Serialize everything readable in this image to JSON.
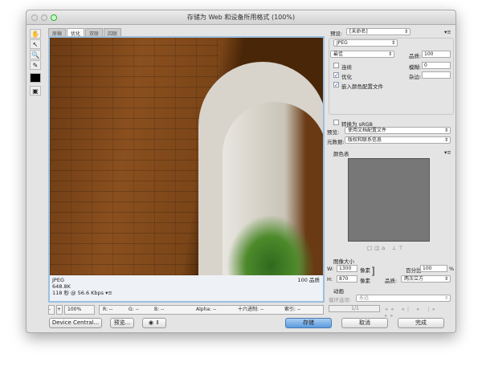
{
  "window": {
    "title": "存储为 Web 和设备所用格式 (100%)"
  },
  "tabs": [
    "原稿",
    "优化",
    "双联",
    "四联"
  ],
  "active_tab": 1,
  "image_info": {
    "format": "JPEG",
    "size": "648.8K",
    "time": "118 秒 @ 56.6 Kbps",
    "menu": "▾≡",
    "quality": "100 品质"
  },
  "status_bar": {
    "zoom": "100%",
    "r": "R: --",
    "g": "G: --",
    "b": "B: --",
    "alpha": "Alpha: --",
    "hex": "十六进制: --",
    "index": "索引: --"
  },
  "buttons": {
    "device_central": "Device Central...",
    "preview": "预览...",
    "save": "存储",
    "cancel": "取消",
    "done": "完成"
  },
  "settings": {
    "preset_label": "预设:",
    "preset": "[未命名]",
    "format": "JPEG",
    "quality_preset": "最佳",
    "quality_label": "品质:",
    "quality": "100",
    "progressive": "连续",
    "progressive_checked": false,
    "blur_label": "模糊:",
    "blur": "0",
    "optimized": "优化",
    "optimized_checked": true,
    "matte_label": "杂边:",
    "matte": "",
    "embed_profile": "嵌入颜色配置文件",
    "embed_checked": true,
    "srgb": "转换为 sRGB",
    "srgb_checked": false,
    "preview_label": "预览:",
    "preview": "使用文档配置文件",
    "metadata_label": "元数据:",
    "metadata": "版权和联系信息"
  },
  "color_table": {
    "title": "颜色表"
  },
  "image_size": {
    "title": "图像大小",
    "w_label": "W:",
    "w": "1300",
    "h_label": "H:",
    "h": "870",
    "unit": "像素",
    "percent_label": "百分比:",
    "percent": "100",
    "percent_unit": "%",
    "quality_label": "品质:",
    "quality": "两次立方"
  },
  "animation": {
    "title": "动画",
    "loop_label": "循环选项:",
    "loop": "永远",
    "frame": "1/1"
  }
}
